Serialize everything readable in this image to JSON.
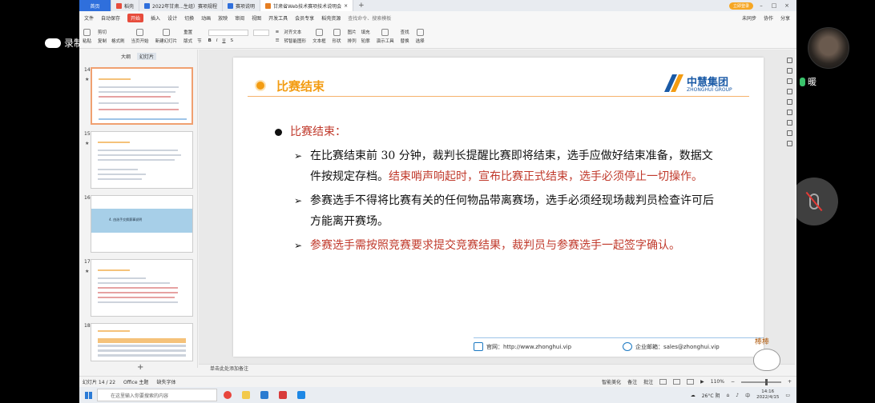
{
  "overlay": {
    "recording_label": "录制中",
    "username": "暖"
  },
  "tabs": [
    {
      "label": "首页",
      "kind": "home"
    },
    {
      "label": "稻壳",
      "icon_color": "#e74c3c"
    },
    {
      "label": "2022年甘肃...生组）赛项规程",
      "icon_color": "#2f6fdc"
    },
    {
      "label": "赛项说明",
      "icon_color": "#2f6fdc"
    },
    {
      "label": "甘肃省Web技术赛项技术说明会",
      "icon_color": "#e67e22",
      "active": true
    }
  ],
  "tabbar_right": {
    "login": "立即登录"
  },
  "menubar": {
    "file": "文件",
    "autosave": "自动保存",
    "items": [
      "开始",
      "插入",
      "设计",
      "切换",
      "动画",
      "放映",
      "审阅",
      "视图",
      "开发工具",
      "会员专享",
      "稻壳资源"
    ],
    "search": "查找命令、搜索模板",
    "right": [
      "未同步",
      "协作",
      "分享"
    ]
  },
  "ribbon": {
    "clipboard": [
      "剪切",
      "复制",
      "格式刷"
    ],
    "paste": "粘贴",
    "from_start": "当页开始",
    "new_slide": "新建幻灯片",
    "layout": "版式",
    "section": "节",
    "reset": "重置",
    "text_box": "文本框",
    "shape": "形状",
    "arrange": "排列",
    "picture": "图片",
    "fill": "填充",
    "outline": "轮廓",
    "tools": "演示工具",
    "find": "查找",
    "replace": "替换",
    "select": "选择",
    "smart_graphic": "转智能图形",
    "textbox_hint": "对齐文本"
  },
  "left_panel": {
    "tab_outline": "大纲",
    "tab_slides": "幻灯片",
    "thumbs": [
      {
        "num": "14"
      },
      {
        "num": "15"
      },
      {
        "num": "16",
        "banner": "4. 由选手交换赛事说明"
      },
      {
        "num": "17"
      },
      {
        "num": "18"
      }
    ]
  },
  "slide": {
    "title": "比赛结束",
    "logo_cn": "中慧集团",
    "logo_en": "ZHONGHUI GROUP",
    "heading": "比赛结束：",
    "items": [
      {
        "normal": "在比赛结束前 30 分钟，裁判长提醒比赛即将结束，选手应做好结束准备，数据文件按规定存档。",
        "red": "结束哨声响起时，宣布比赛正式结束，选手必须停止一切操作。"
      },
      {
        "normal": "参赛选手不得将比赛有关的任何物品带离赛场，选手必须经现场裁判员检查许可后方能离开赛场。",
        "red": ""
      },
      {
        "normal": "",
        "red": "参赛选手需按照竞赛要求提交竞赛结果，裁判员与参赛选手一起签字确认。"
      }
    ],
    "footer_web": "官网：http://www.zhonghui.vip",
    "footer_mail": "企业邮箱：sales@zhonghui.vip"
  },
  "notes_placeholder": "单击此处添加备注",
  "statusbar": {
    "slide_counter": "幻灯片 14 / 22",
    "theme": "Office 主题",
    "missing_font": "缺失字体",
    "smart_beautify": "智能美化",
    "notes_btn": "备注",
    "comments_btn": "批注",
    "zoom": "110%"
  },
  "taskbar": {
    "search_placeholder": "在这里输入你要搜索的内容",
    "weather": "26°C 阴",
    "ime": "中",
    "time": "14:16",
    "date": "2022/4/15"
  },
  "sticker": {
    "text": "棒棒"
  },
  "colors": {
    "accent_orange": "#f39c12",
    "red_text": "#c0392b",
    "brand_blue": "#1a5aa6",
    "start_tab": "#e74c3c"
  }
}
